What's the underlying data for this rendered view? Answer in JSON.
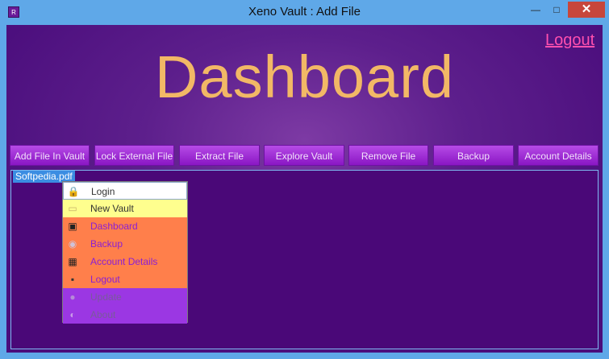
{
  "window": {
    "title": "Xeno Vault : Add File",
    "icon_letter": "R"
  },
  "controls": {
    "minimize": "—",
    "maximize": "□",
    "close": "✕"
  },
  "header": {
    "logout_label": "Logout",
    "dashboard_title": "Dashboard"
  },
  "nav": [
    "Add File In Vault",
    "Lock External File",
    "Extract File",
    "Explore Vault",
    "Remove File",
    "Backup",
    "Account Details"
  ],
  "files": [
    "Softpedia.pdf"
  ],
  "context_menu": [
    {
      "label": "Login",
      "icon": "lock-icon",
      "glyph": "🔒"
    },
    {
      "label": "New Vault",
      "icon": "vault-icon",
      "glyph": "▭"
    },
    {
      "label": "Dashboard",
      "icon": "dashboard-icon",
      "glyph": "▣"
    },
    {
      "label": "Backup",
      "icon": "backup-icon",
      "glyph": "◉"
    },
    {
      "label": "Account Details",
      "icon": "account-icon",
      "glyph": "▦"
    },
    {
      "label": "Logout",
      "icon": "logout-icon",
      "glyph": "▪"
    },
    {
      "label": "Update",
      "icon": "update-icon",
      "glyph": "●"
    },
    {
      "label": "About",
      "icon": "about-icon",
      "glyph": "◐"
    }
  ],
  "colors": {
    "accent_pink": "#ff4fae",
    "title_gold": "#f2b866",
    "menu_yellow": "#fefe8e",
    "menu_orange": "#ff7f4b",
    "menu_purple": "#9b37e3"
  }
}
